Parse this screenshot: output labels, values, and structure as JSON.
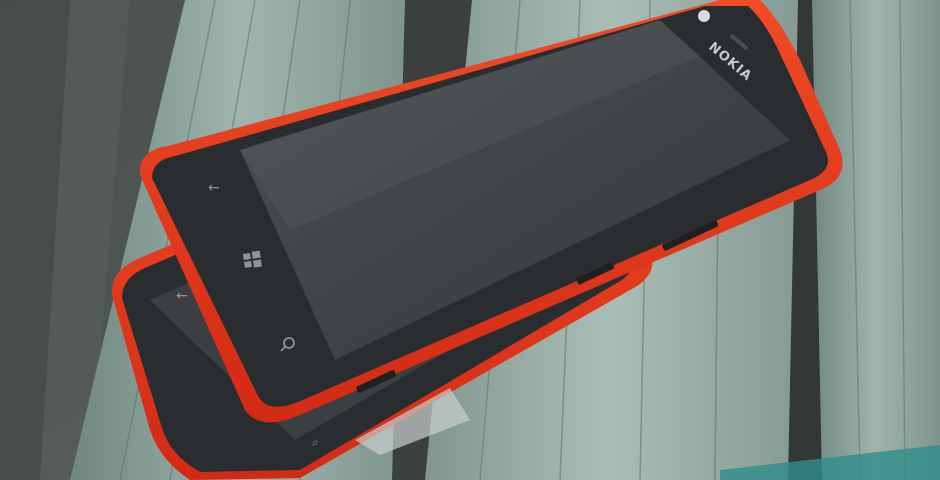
{
  "photo": {
    "front_phone": {
      "brand_text": "NOKIA",
      "back_icon": "back-arrow-icon",
      "home_icon": "windows-logo-icon",
      "search_icon": "search-icon"
    },
    "back_phone": {
      "back_icon": "back-arrow-icon",
      "search_icon": "search-icon"
    },
    "colors": {
      "phone_body": "#e8341c",
      "screen": "#3e4244",
      "bezel": "#2a2d2f",
      "bench_wood": "#8ea79f",
      "background": "#4e5552"
    }
  }
}
